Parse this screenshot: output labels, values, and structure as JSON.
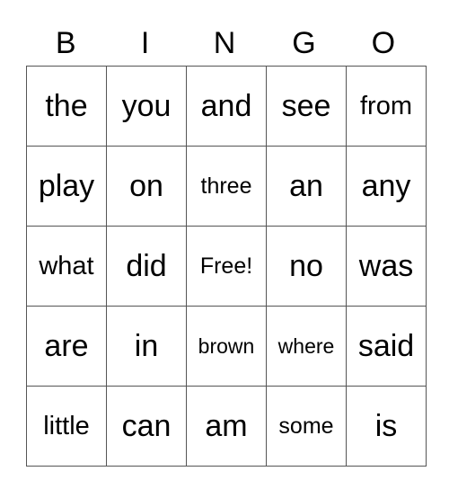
{
  "header": [
    "B",
    "I",
    "N",
    "G",
    "O"
  ],
  "rows": [
    [
      "the",
      "you",
      "and",
      "see",
      "from"
    ],
    [
      "play",
      "on",
      "three",
      "an",
      "any"
    ],
    [
      "what",
      "did",
      "Free!",
      "no",
      "was"
    ],
    [
      "are",
      "in",
      "brown",
      "where",
      "said"
    ],
    [
      "little",
      "can",
      "am",
      "some",
      "is"
    ]
  ]
}
